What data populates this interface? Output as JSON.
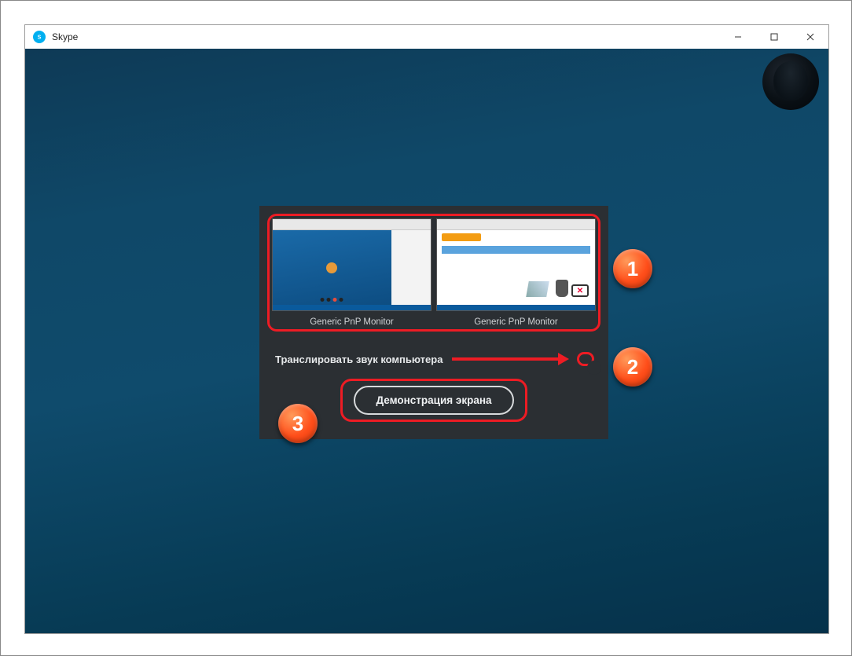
{
  "window": {
    "title": "Skype"
  },
  "dialog": {
    "monitors": [
      {
        "label": "Generic PnP Monitor"
      },
      {
        "label": "Generic PnP Monitor"
      }
    ],
    "audio_label": "Транслировать звук компьютера",
    "share_button": "Демонстрация экрана"
  },
  "annotations": {
    "n1": "1",
    "n2": "2",
    "n3": "3"
  }
}
